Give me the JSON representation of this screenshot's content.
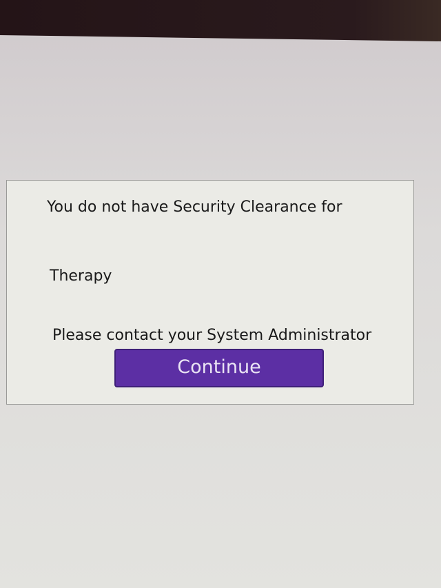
{
  "dialog": {
    "line1": "You do not have Security Clearance for",
    "module": "Therapy",
    "line3": "Please contact your System Administrator",
    "continue_label": "Continue"
  },
  "colors": {
    "button": "#5c2fa4",
    "button_text": "#eae4f4"
  }
}
